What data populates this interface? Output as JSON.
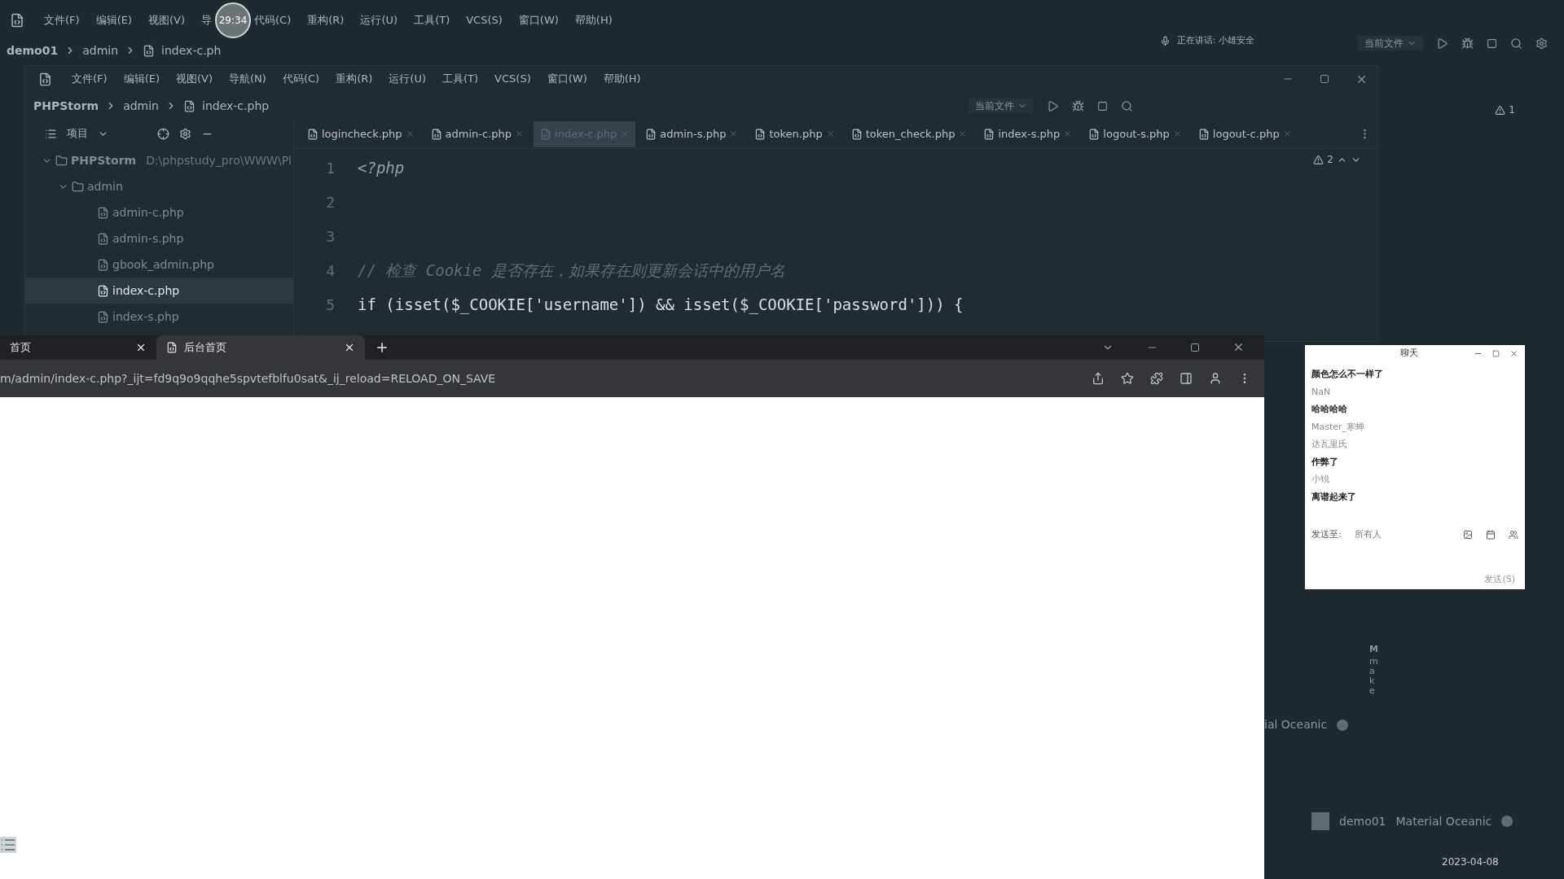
{
  "back_ide": {
    "menu": [
      "文件(F)",
      "编辑(E)",
      "视图(V)",
      "导",
      "代码(C)",
      "重构(R)",
      "运行(U)",
      "工具(T)",
      "VCS(S)",
      "窗口(W)",
      "帮助(H)"
    ],
    "breadcrumb": [
      "demo01",
      "admin",
      "index-c.ph"
    ],
    "speaking": "正在讲话: 小雄安全",
    "run_config": "当前文件",
    "warnings": "1",
    "theme_partial": "ial Oceanic",
    "side_letter": "M",
    "side_text": "make",
    "status_bar": {
      "project": "demo01",
      "theme": "Material Oceanic"
    },
    "taskbar": {
      "date": "2023-04-08"
    }
  },
  "recording_timer": "29:34",
  "front_ide": {
    "menu": [
      "文件(F)",
      "编辑(E)",
      "视图(V)",
      "导航(N)",
      "代码(C)",
      "重构(R)",
      "运行(U)",
      "工具(T)",
      "VCS(S)",
      "窗口(W)",
      "帮助(H)"
    ],
    "breadcrumb": [
      "PHPStorm",
      "admin",
      "index-c.php"
    ],
    "run_config": "当前文件",
    "project_panel": {
      "title": "项目",
      "tree": [
        {
          "label": "PHPStorm",
          "path": "D:\\phpstudy_pro\\WWW\\Pl",
          "expanded": true,
          "selected": false,
          "children": [
            {
              "label": "admin",
              "expanded": true,
              "selected": false,
              "children": [
                {
                  "label": "admin-c.php",
                  "selected": false
                },
                {
                  "label": "admin-s.php",
                  "selected": false
                },
                {
                  "label": "gbook_admin.php",
                  "selected": false
                },
                {
                  "label": "index-c.php",
                  "selected": true
                },
                {
                  "label": "index-s.php",
                  "selected": false
                }
              ]
            }
          ]
        }
      ]
    },
    "tabs": [
      {
        "label": "logincheck.php",
        "selected": false
      },
      {
        "label": "admin-c.php",
        "selected": false
      },
      {
        "label": "index-c.php",
        "selected": true
      },
      {
        "label": "admin-s.php",
        "selected": false
      },
      {
        "label": "token.php",
        "selected": false
      },
      {
        "label": "token_check.php",
        "selected": false
      },
      {
        "label": "index-s.php",
        "selected": false
      },
      {
        "label": "logout-s.php",
        "selected": false
      },
      {
        "label": "logout-c.php",
        "selected": false
      }
    ],
    "warnings": "2",
    "code": [
      {
        "line": "1",
        "text": "<?php",
        "kind": "keyword"
      },
      {
        "line": "2",
        "kind": "blank"
      },
      {
        "line": "3",
        "kind": "blank"
      },
      {
        "line": "4",
        "text": "// 检查 Cookie 是否存在，如果存在则更新会话中的用户名",
        "kind": "comment"
      },
      {
        "line": "5",
        "text": "if (isset($_COOKIE['username']) && isset($_COOKIE['password'])) {",
        "kind": "code"
      }
    ]
  },
  "browser": {
    "tabs": [
      {
        "title": "首页",
        "selected": false
      },
      {
        "title": "后台首页",
        "selected": true
      }
    ],
    "url": "m/admin/index-c.php?_ijt=fd9q9o9qqhe5spvtefblfu0sat&_ij_reload=RELOAD_ON_SAVE"
  },
  "chat": {
    "title": "聊天",
    "messages": [
      {
        "text": "颜色怎么不一样了",
        "kind": "message"
      },
      {
        "text": "NaN",
        "kind": "sender"
      },
      {
        "text": "哈哈哈哈",
        "kind": "message"
      },
      {
        "text": "Master_寒蝉",
        "kind": "sender"
      },
      {
        "text": "达瓦里氏",
        "kind": "sender"
      },
      {
        "text": "作弊了",
        "kind": "message"
      },
      {
        "text": "小锐",
        "kind": "sender"
      },
      {
        "text": "离谱起来了",
        "kind": "message"
      }
    ],
    "send_to_label": "发送至:",
    "recipient": "所有人",
    "send_button": "发送(S)"
  }
}
